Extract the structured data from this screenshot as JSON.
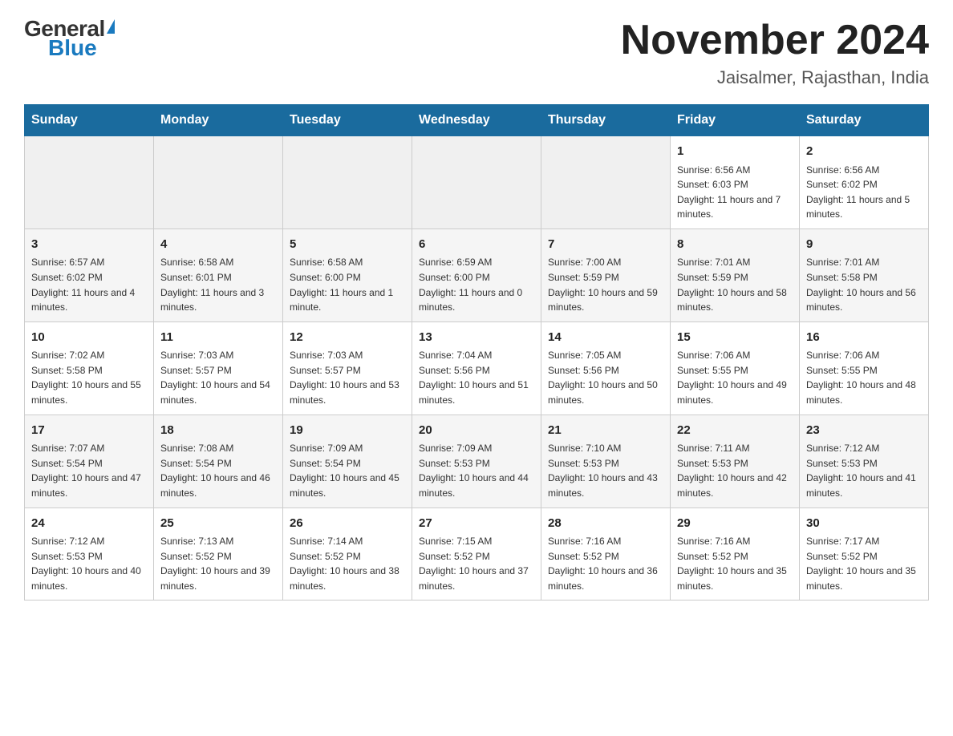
{
  "logo": {
    "general": "General",
    "blue": "Blue"
  },
  "title": {
    "month_year": "November 2024",
    "location": "Jaisalmer, Rajasthan, India"
  },
  "days_of_week": [
    "Sunday",
    "Monday",
    "Tuesday",
    "Wednesday",
    "Thursday",
    "Friday",
    "Saturday"
  ],
  "weeks": [
    [
      {
        "day": "",
        "info": ""
      },
      {
        "day": "",
        "info": ""
      },
      {
        "day": "",
        "info": ""
      },
      {
        "day": "",
        "info": ""
      },
      {
        "day": "",
        "info": ""
      },
      {
        "day": "1",
        "info": "Sunrise: 6:56 AM\nSunset: 6:03 PM\nDaylight: 11 hours and 7 minutes."
      },
      {
        "day": "2",
        "info": "Sunrise: 6:56 AM\nSunset: 6:02 PM\nDaylight: 11 hours and 5 minutes."
      }
    ],
    [
      {
        "day": "3",
        "info": "Sunrise: 6:57 AM\nSunset: 6:02 PM\nDaylight: 11 hours and 4 minutes."
      },
      {
        "day": "4",
        "info": "Sunrise: 6:58 AM\nSunset: 6:01 PM\nDaylight: 11 hours and 3 minutes."
      },
      {
        "day": "5",
        "info": "Sunrise: 6:58 AM\nSunset: 6:00 PM\nDaylight: 11 hours and 1 minute."
      },
      {
        "day": "6",
        "info": "Sunrise: 6:59 AM\nSunset: 6:00 PM\nDaylight: 11 hours and 0 minutes."
      },
      {
        "day": "7",
        "info": "Sunrise: 7:00 AM\nSunset: 5:59 PM\nDaylight: 10 hours and 59 minutes."
      },
      {
        "day": "8",
        "info": "Sunrise: 7:01 AM\nSunset: 5:59 PM\nDaylight: 10 hours and 58 minutes."
      },
      {
        "day": "9",
        "info": "Sunrise: 7:01 AM\nSunset: 5:58 PM\nDaylight: 10 hours and 56 minutes."
      }
    ],
    [
      {
        "day": "10",
        "info": "Sunrise: 7:02 AM\nSunset: 5:58 PM\nDaylight: 10 hours and 55 minutes."
      },
      {
        "day": "11",
        "info": "Sunrise: 7:03 AM\nSunset: 5:57 PM\nDaylight: 10 hours and 54 minutes."
      },
      {
        "day": "12",
        "info": "Sunrise: 7:03 AM\nSunset: 5:57 PM\nDaylight: 10 hours and 53 minutes."
      },
      {
        "day": "13",
        "info": "Sunrise: 7:04 AM\nSunset: 5:56 PM\nDaylight: 10 hours and 51 minutes."
      },
      {
        "day": "14",
        "info": "Sunrise: 7:05 AM\nSunset: 5:56 PM\nDaylight: 10 hours and 50 minutes."
      },
      {
        "day": "15",
        "info": "Sunrise: 7:06 AM\nSunset: 5:55 PM\nDaylight: 10 hours and 49 minutes."
      },
      {
        "day": "16",
        "info": "Sunrise: 7:06 AM\nSunset: 5:55 PM\nDaylight: 10 hours and 48 minutes."
      }
    ],
    [
      {
        "day": "17",
        "info": "Sunrise: 7:07 AM\nSunset: 5:54 PM\nDaylight: 10 hours and 47 minutes."
      },
      {
        "day": "18",
        "info": "Sunrise: 7:08 AM\nSunset: 5:54 PM\nDaylight: 10 hours and 46 minutes."
      },
      {
        "day": "19",
        "info": "Sunrise: 7:09 AM\nSunset: 5:54 PM\nDaylight: 10 hours and 45 minutes."
      },
      {
        "day": "20",
        "info": "Sunrise: 7:09 AM\nSunset: 5:53 PM\nDaylight: 10 hours and 44 minutes."
      },
      {
        "day": "21",
        "info": "Sunrise: 7:10 AM\nSunset: 5:53 PM\nDaylight: 10 hours and 43 minutes."
      },
      {
        "day": "22",
        "info": "Sunrise: 7:11 AM\nSunset: 5:53 PM\nDaylight: 10 hours and 42 minutes."
      },
      {
        "day": "23",
        "info": "Sunrise: 7:12 AM\nSunset: 5:53 PM\nDaylight: 10 hours and 41 minutes."
      }
    ],
    [
      {
        "day": "24",
        "info": "Sunrise: 7:12 AM\nSunset: 5:53 PM\nDaylight: 10 hours and 40 minutes."
      },
      {
        "day": "25",
        "info": "Sunrise: 7:13 AM\nSunset: 5:52 PM\nDaylight: 10 hours and 39 minutes."
      },
      {
        "day": "26",
        "info": "Sunrise: 7:14 AM\nSunset: 5:52 PM\nDaylight: 10 hours and 38 minutes."
      },
      {
        "day": "27",
        "info": "Sunrise: 7:15 AM\nSunset: 5:52 PM\nDaylight: 10 hours and 37 minutes."
      },
      {
        "day": "28",
        "info": "Sunrise: 7:16 AM\nSunset: 5:52 PM\nDaylight: 10 hours and 36 minutes."
      },
      {
        "day": "29",
        "info": "Sunrise: 7:16 AM\nSunset: 5:52 PM\nDaylight: 10 hours and 35 minutes."
      },
      {
        "day": "30",
        "info": "Sunrise: 7:17 AM\nSunset: 5:52 PM\nDaylight: 10 hours and 35 minutes."
      }
    ]
  ]
}
